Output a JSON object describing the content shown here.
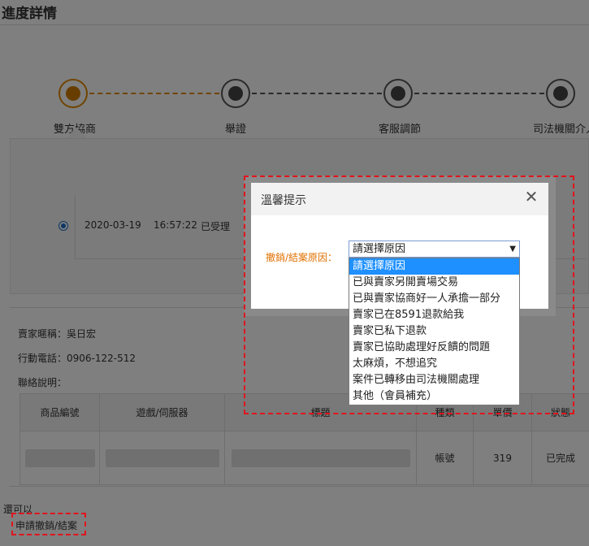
{
  "page": {
    "title": "進度詳情"
  },
  "progress": {
    "steps": [
      {
        "label": "雙方協商",
        "state": "active"
      },
      {
        "label": "舉證",
        "state": "idle"
      },
      {
        "label": "客服調節",
        "state": "idle"
      },
      {
        "label": "司法機關介入",
        "state": "idle"
      }
    ]
  },
  "timeline": {
    "entries": [
      {
        "date": "2020-03-19",
        "time": "16:57:22",
        "status": "已受理"
      }
    ]
  },
  "seller": {
    "nickname_label": "賣家暱稱：",
    "nickname": "吳日宏",
    "phone_label": "行動電話：",
    "phone": "0906-122-512",
    "contact_label": "聯絡說明："
  },
  "table": {
    "headers": [
      "商品編號",
      "遊戲/伺服器",
      "標題",
      "種類",
      "單價",
      "狀態"
    ],
    "rows": [
      {
        "item_no": "",
        "game_server": "",
        "title": "",
        "type": "帳號",
        "price": "319",
        "status": "已完成"
      }
    ]
  },
  "footer": {
    "text": "還可以",
    "apply_link": "申請撤銷/結案"
  },
  "dialog": {
    "title": "溫馨提示",
    "close_glyph": "✕",
    "reason_label": "撤銷/結案原因：",
    "select_value": "請選擇原因",
    "options": [
      "請選擇原因",
      "已與賣家另開賣場交易",
      "已與賣家協商好一人承擔一部分",
      "賣家已在8591退款給我",
      "賣家已私下退款",
      "賣家已協助處理好反饋的問題",
      "太麻煩，不想追究",
      "案件已轉移由司法機關處理",
      "其他（會員補充）"
    ]
  },
  "colors": {
    "accent": "#e08a00",
    "highlight": "#e0141e",
    "selection": "#1e90ff"
  }
}
